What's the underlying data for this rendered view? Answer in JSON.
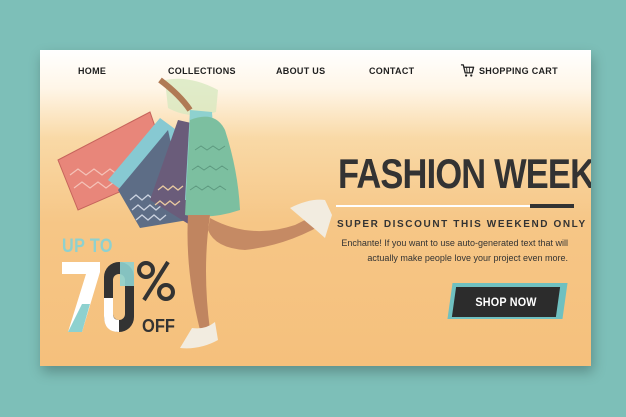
{
  "nav": {
    "home": "HOME",
    "collections": "COLLECTIONS",
    "about": "ABOUT US",
    "contact": "CONTACT",
    "cart": "SHOPPING CART",
    "cart_icon": "shopping-cart-icon"
  },
  "hero": {
    "title": "FASHION WEEK",
    "subtitle": "SUPER DISCOUNT THIS WEEKEND ONLY",
    "description": "Enchante! If you want to use auto-generated text that will actually make people love your project even more.",
    "cta": "SHOP NOW"
  },
  "promo": {
    "up_to": "UP TO",
    "amount": "70",
    "percent_sign": "%",
    "off": "OFF"
  },
  "colors": {
    "background": "#7dbfb8",
    "accent": "#8ed1cf",
    "dark": "#2c2c2c",
    "peach": "#f5c07c"
  }
}
